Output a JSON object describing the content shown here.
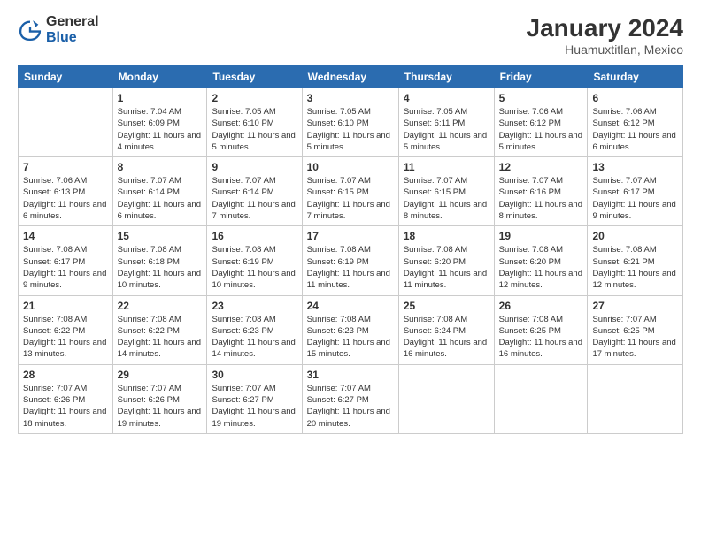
{
  "header": {
    "logo_general": "General",
    "logo_blue": "Blue",
    "title": "January 2024",
    "subtitle": "Huamuxtitlan, Mexico"
  },
  "days": [
    "Sunday",
    "Monday",
    "Tuesday",
    "Wednesday",
    "Thursday",
    "Friday",
    "Saturday"
  ],
  "weeks": [
    [
      {
        "date": "",
        "sunrise": "",
        "sunset": "",
        "daylight": ""
      },
      {
        "date": "1",
        "sunrise": "Sunrise: 7:04 AM",
        "sunset": "Sunset: 6:09 PM",
        "daylight": "Daylight: 11 hours and 4 minutes."
      },
      {
        "date": "2",
        "sunrise": "Sunrise: 7:05 AM",
        "sunset": "Sunset: 6:10 PM",
        "daylight": "Daylight: 11 hours and 5 minutes."
      },
      {
        "date": "3",
        "sunrise": "Sunrise: 7:05 AM",
        "sunset": "Sunset: 6:10 PM",
        "daylight": "Daylight: 11 hours and 5 minutes."
      },
      {
        "date": "4",
        "sunrise": "Sunrise: 7:05 AM",
        "sunset": "Sunset: 6:11 PM",
        "daylight": "Daylight: 11 hours and 5 minutes."
      },
      {
        "date": "5",
        "sunrise": "Sunrise: 7:06 AM",
        "sunset": "Sunset: 6:12 PM",
        "daylight": "Daylight: 11 hours and 5 minutes."
      },
      {
        "date": "6",
        "sunrise": "Sunrise: 7:06 AM",
        "sunset": "Sunset: 6:12 PM",
        "daylight": "Daylight: 11 hours and 6 minutes."
      }
    ],
    [
      {
        "date": "7",
        "sunrise": "Sunrise: 7:06 AM",
        "sunset": "Sunset: 6:13 PM",
        "daylight": "Daylight: 11 hours and 6 minutes."
      },
      {
        "date": "8",
        "sunrise": "Sunrise: 7:07 AM",
        "sunset": "Sunset: 6:14 PM",
        "daylight": "Daylight: 11 hours and 6 minutes."
      },
      {
        "date": "9",
        "sunrise": "Sunrise: 7:07 AM",
        "sunset": "Sunset: 6:14 PM",
        "daylight": "Daylight: 11 hours and 7 minutes."
      },
      {
        "date": "10",
        "sunrise": "Sunrise: 7:07 AM",
        "sunset": "Sunset: 6:15 PM",
        "daylight": "Daylight: 11 hours and 7 minutes."
      },
      {
        "date": "11",
        "sunrise": "Sunrise: 7:07 AM",
        "sunset": "Sunset: 6:15 PM",
        "daylight": "Daylight: 11 hours and 8 minutes."
      },
      {
        "date": "12",
        "sunrise": "Sunrise: 7:07 AM",
        "sunset": "Sunset: 6:16 PM",
        "daylight": "Daylight: 11 hours and 8 minutes."
      },
      {
        "date": "13",
        "sunrise": "Sunrise: 7:07 AM",
        "sunset": "Sunset: 6:17 PM",
        "daylight": "Daylight: 11 hours and 9 minutes."
      }
    ],
    [
      {
        "date": "14",
        "sunrise": "Sunrise: 7:08 AM",
        "sunset": "Sunset: 6:17 PM",
        "daylight": "Daylight: 11 hours and 9 minutes."
      },
      {
        "date": "15",
        "sunrise": "Sunrise: 7:08 AM",
        "sunset": "Sunset: 6:18 PM",
        "daylight": "Daylight: 11 hours and 10 minutes."
      },
      {
        "date": "16",
        "sunrise": "Sunrise: 7:08 AM",
        "sunset": "Sunset: 6:19 PM",
        "daylight": "Daylight: 11 hours and 10 minutes."
      },
      {
        "date": "17",
        "sunrise": "Sunrise: 7:08 AM",
        "sunset": "Sunset: 6:19 PM",
        "daylight": "Daylight: 11 hours and 11 minutes."
      },
      {
        "date": "18",
        "sunrise": "Sunrise: 7:08 AM",
        "sunset": "Sunset: 6:20 PM",
        "daylight": "Daylight: 11 hours and 11 minutes."
      },
      {
        "date": "19",
        "sunrise": "Sunrise: 7:08 AM",
        "sunset": "Sunset: 6:20 PM",
        "daylight": "Daylight: 11 hours and 12 minutes."
      },
      {
        "date": "20",
        "sunrise": "Sunrise: 7:08 AM",
        "sunset": "Sunset: 6:21 PM",
        "daylight": "Daylight: 11 hours and 12 minutes."
      }
    ],
    [
      {
        "date": "21",
        "sunrise": "Sunrise: 7:08 AM",
        "sunset": "Sunset: 6:22 PM",
        "daylight": "Daylight: 11 hours and 13 minutes."
      },
      {
        "date": "22",
        "sunrise": "Sunrise: 7:08 AM",
        "sunset": "Sunset: 6:22 PM",
        "daylight": "Daylight: 11 hours and 14 minutes."
      },
      {
        "date": "23",
        "sunrise": "Sunrise: 7:08 AM",
        "sunset": "Sunset: 6:23 PM",
        "daylight": "Daylight: 11 hours and 14 minutes."
      },
      {
        "date": "24",
        "sunrise": "Sunrise: 7:08 AM",
        "sunset": "Sunset: 6:23 PM",
        "daylight": "Daylight: 11 hours and 15 minutes."
      },
      {
        "date": "25",
        "sunrise": "Sunrise: 7:08 AM",
        "sunset": "Sunset: 6:24 PM",
        "daylight": "Daylight: 11 hours and 16 minutes."
      },
      {
        "date": "26",
        "sunrise": "Sunrise: 7:08 AM",
        "sunset": "Sunset: 6:25 PM",
        "daylight": "Daylight: 11 hours and 16 minutes."
      },
      {
        "date": "27",
        "sunrise": "Sunrise: 7:07 AM",
        "sunset": "Sunset: 6:25 PM",
        "daylight": "Daylight: 11 hours and 17 minutes."
      }
    ],
    [
      {
        "date": "28",
        "sunrise": "Sunrise: 7:07 AM",
        "sunset": "Sunset: 6:26 PM",
        "daylight": "Daylight: 11 hours and 18 minutes."
      },
      {
        "date": "29",
        "sunrise": "Sunrise: 7:07 AM",
        "sunset": "Sunset: 6:26 PM",
        "daylight": "Daylight: 11 hours and 19 minutes."
      },
      {
        "date": "30",
        "sunrise": "Sunrise: 7:07 AM",
        "sunset": "Sunset: 6:27 PM",
        "daylight": "Daylight: 11 hours and 19 minutes."
      },
      {
        "date": "31",
        "sunrise": "Sunrise: 7:07 AM",
        "sunset": "Sunset: 6:27 PM",
        "daylight": "Daylight: 11 hours and 20 minutes."
      },
      {
        "date": "",
        "sunrise": "",
        "sunset": "",
        "daylight": ""
      },
      {
        "date": "",
        "sunrise": "",
        "sunset": "",
        "daylight": ""
      },
      {
        "date": "",
        "sunrise": "",
        "sunset": "",
        "daylight": ""
      }
    ]
  ]
}
